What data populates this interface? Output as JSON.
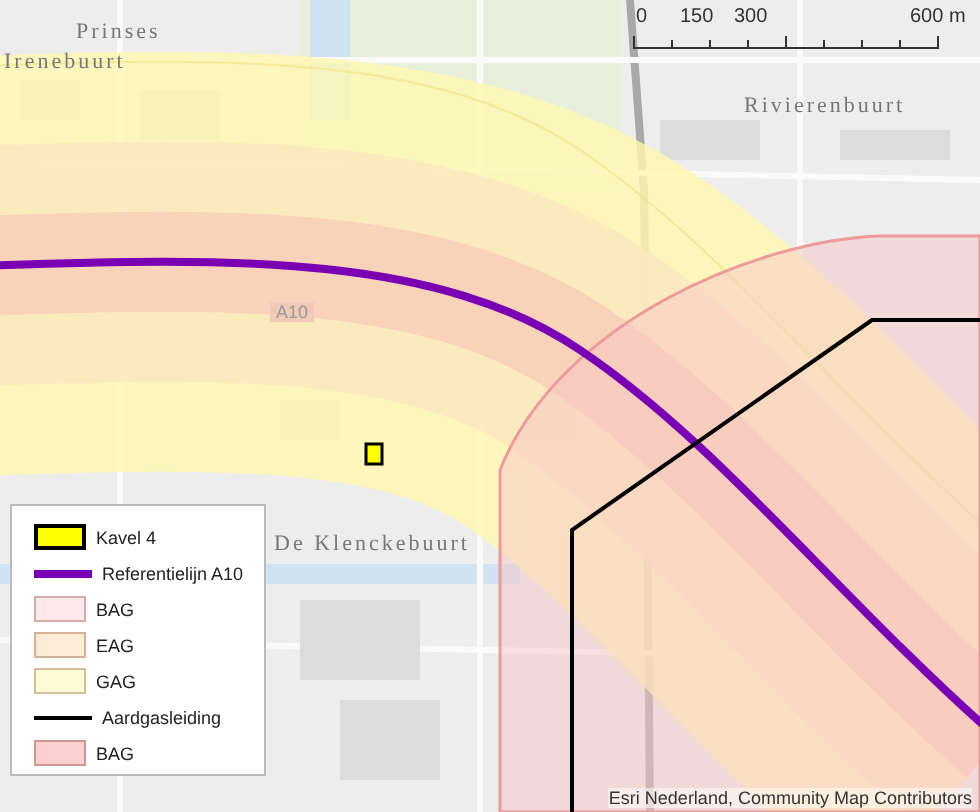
{
  "map": {
    "labels": [
      {
        "text": "Prinses",
        "kind": "area"
      },
      {
        "text": "Irenebuurt",
        "kind": "area"
      },
      {
        "text": "Rivierenbuurt",
        "kind": "area"
      },
      {
        "text": "A10",
        "kind": "road"
      },
      {
        "text": "De Klenckebuurt",
        "kind": "area"
      }
    ]
  },
  "scale_bar": {
    "ticks": [
      "0",
      "150",
      "300",
      "600 m"
    ]
  },
  "legend": {
    "items": [
      {
        "label": "Kavel 4",
        "kind": "box",
        "color": "#ffff00"
      },
      {
        "label": "Referentielijn A10",
        "kind": "line",
        "color": "#7a00b4"
      },
      {
        "label": "BAG",
        "kind": "box",
        "color": "#fde8e8"
      },
      {
        "label": "EAG",
        "kind": "box",
        "color": "#fdedd6"
      },
      {
        "label": "GAG",
        "kind": "box",
        "color": "#fdfbd6"
      },
      {
        "label": "Aardgasleiding",
        "kind": "line",
        "color": "#000000"
      },
      {
        "label": "BAG",
        "kind": "box",
        "color": "#fbd0d0"
      }
    ]
  },
  "attribution": "Esri Nederland, Community Map Contributors"
}
